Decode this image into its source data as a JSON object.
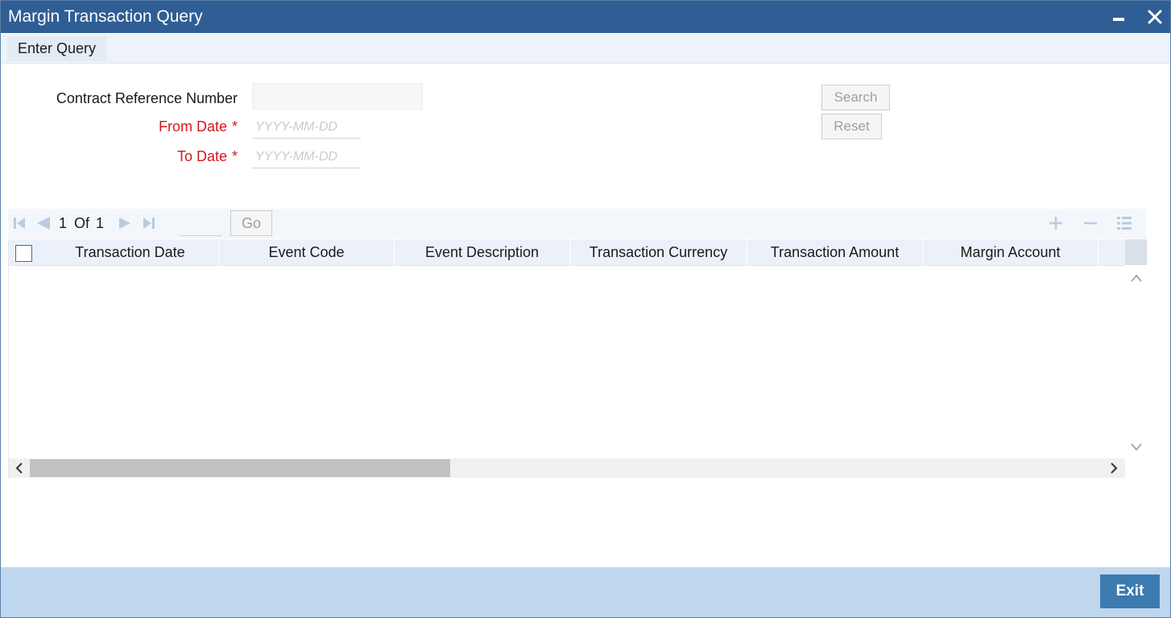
{
  "window": {
    "title": "Margin Transaction Query",
    "minimize_icon": "minimize-icon",
    "close_icon": "close-icon"
  },
  "menu": {
    "items": [
      {
        "label": "Enter Query"
      }
    ]
  },
  "form": {
    "contract_ref_label": "Contract Reference Number",
    "contract_ref_value": "",
    "from_date_label": "From Date",
    "from_date_placeholder": "YYYY-MM-DD",
    "to_date_label": "To Date",
    "to_date_placeholder": "YYYY-MM-DD",
    "required_marker": "*",
    "search_label": "Search",
    "reset_label": "Reset"
  },
  "pager": {
    "current_page": "1",
    "of_label": "Of",
    "total_pages": "1",
    "go_label": "Go",
    "icons": [
      "first-page-icon",
      "prev-page-icon",
      "next-page-icon",
      "last-page-icon",
      "add-row-icon",
      "delete-row-icon",
      "columns-icon"
    ]
  },
  "grid": {
    "columns": [
      "Transaction Date",
      "Event Code",
      "Event Description",
      "Transaction Currency",
      "Transaction Amount",
      "Margin Account"
    ],
    "rows": []
  },
  "footer": {
    "exit_label": "Exit"
  },
  "colors": {
    "titlebar": "#2f5e95",
    "required_text": "#d8161f",
    "footer": "#bfd7ee",
    "exit_button": "#3c7bb0"
  }
}
